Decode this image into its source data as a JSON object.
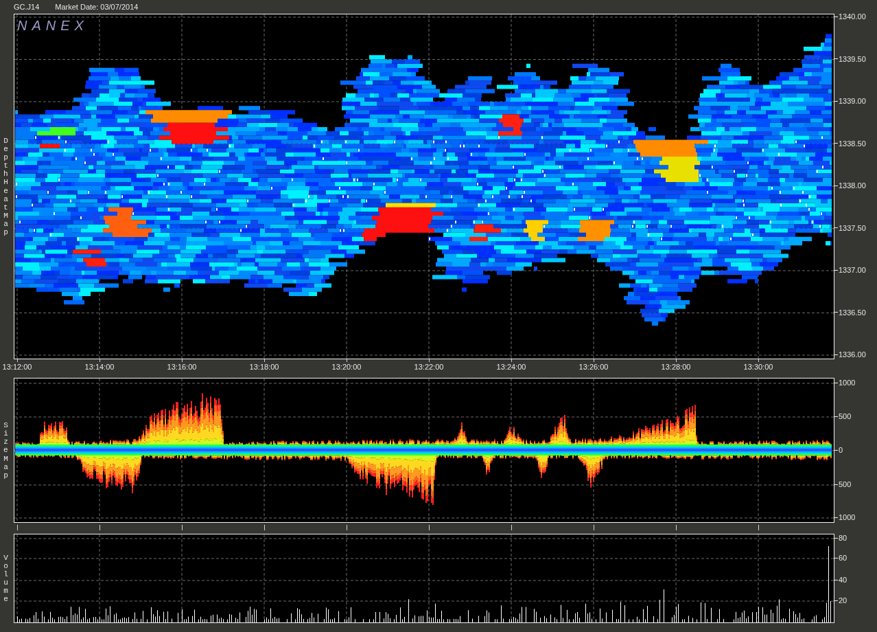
{
  "header": {
    "symbol": "GC.J14",
    "market_date": "Market Date: 03/07/2014"
  },
  "panels": [
    {
      "kind": "heatmap",
      "label": "Depth Heat Map",
      "logo": "NANEX",
      "y_labels": [
        "1340.00",
        "1339.50",
        "1339.00",
        "1338.50",
        "1338.00",
        "1337.50",
        "1337.00",
        "1336.50",
        "1336.00"
      ]
    },
    {
      "kind": "sizemap",
      "label": "Size Map",
      "y_labels": [
        "1000",
        "500",
        "0",
        "500",
        "1000"
      ]
    },
    {
      "kind": "volume",
      "label": "Volume",
      "y_labels": [
        "80",
        "60",
        "40",
        "20"
      ]
    }
  ],
  "time_labels": [
    "13:12:00",
    "13:14:00",
    "13:16:00",
    "13:18:00",
    "13:20:00",
    "13:22:00",
    "13:24:00",
    "13:26:00",
    "13:28:00",
    "13:30:00"
  ]
}
